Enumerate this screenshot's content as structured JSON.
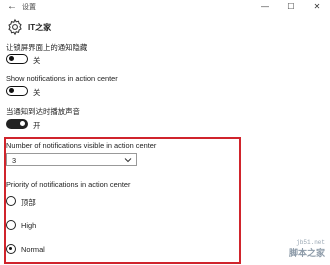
{
  "titlebar": {
    "title": "设置",
    "back_glyph": "←",
    "minimize_glyph": "—",
    "maximize_glyph": "☐",
    "close_glyph": "✕"
  },
  "header": {
    "icon": "gear-icon",
    "app_name": "IT之家"
  },
  "settings": [
    {
      "label": "让锁屏界面上的通知隐藏",
      "state": "off",
      "state_label": "关"
    },
    {
      "label": "Show notifications in action center",
      "state": "off",
      "state_label": "关"
    },
    {
      "label": "当通知到达时播放声音",
      "state": "on",
      "state_label": "开"
    }
  ],
  "visible_count": {
    "label": "Number of notifications visible in action center",
    "selected": "3"
  },
  "priority": {
    "label": "Priority of notifications in action center",
    "options": [
      {
        "label": "顶部",
        "checked": false
      },
      {
        "label": "High",
        "checked": false
      },
      {
        "label": "Normal",
        "checked": true
      }
    ]
  },
  "colors": {
    "highlight_border": "#d0242c",
    "toggle_on": "#222222"
  },
  "watermark": {
    "url": "jb51.net",
    "brand": "脚本之家"
  }
}
